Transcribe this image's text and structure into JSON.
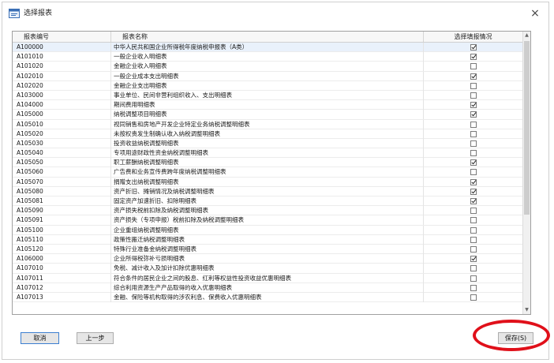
{
  "window": {
    "title": "选择报表",
    "close_glyph": "×"
  },
  "table": {
    "headers": [
      "报表编号",
      "报表名称",
      "选择填报情况"
    ],
    "rows": [
      {
        "code": "A100000",
        "name": "中华人民共和国企业所得税年度纳税申报表（A类）",
        "checked": true
      },
      {
        "code": "A101010",
        "name": "一般企业收入明细表",
        "checked": true
      },
      {
        "code": "A101020",
        "name": "金融企业收入明细表",
        "checked": false
      },
      {
        "code": "A102010",
        "name": "一般企业成本支出明细表",
        "checked": true
      },
      {
        "code": "A102020",
        "name": "金融企业支出明细表",
        "checked": false
      },
      {
        "code": "A103000",
        "name": "事业单位、民间非营利组织收入、支出明细表",
        "checked": false
      },
      {
        "code": "A104000",
        "name": "期间费用明细表",
        "checked": true
      },
      {
        "code": "A105000",
        "name": "纳税调整项目明细表",
        "checked": true
      },
      {
        "code": "A105010",
        "name": "视同销售和房地产开发企业特定业务纳税调整明细表",
        "checked": false
      },
      {
        "code": "A105020",
        "name": "未按权责发生制确认收入纳税调整明细表",
        "checked": false
      },
      {
        "code": "A105030",
        "name": "投资收益纳税调整明细表",
        "checked": false
      },
      {
        "code": "A105040",
        "name": "专项用途财政性资金纳税调整明细表",
        "checked": false
      },
      {
        "code": "A105050",
        "name": "职工薪酬纳税调整明细表",
        "checked": true
      },
      {
        "code": "A105060",
        "name": "广告费和业务宣传费跨年度纳税调整明细表",
        "checked": false
      },
      {
        "code": "A105070",
        "name": "捐赠支出纳税调整明细表",
        "checked": true
      },
      {
        "code": "A105080",
        "name": "资产折旧、摊销情况及纳税调整明细表",
        "checked": true
      },
      {
        "code": "A105081",
        "name": "固定资产加速折旧、扣除明细表",
        "checked": true
      },
      {
        "code": "A105090",
        "name": "资产损失税前扣除及纳税调整明细表",
        "checked": false
      },
      {
        "code": "A105091",
        "name": "资产损失（专项申报）税前扣除及纳税调整明细表",
        "checked": false
      },
      {
        "code": "A105100",
        "name": "企业重组纳税调整明细表",
        "checked": false
      },
      {
        "code": "A105110",
        "name": "政策性搬迁纳税调整明细表",
        "checked": false
      },
      {
        "code": "A105120",
        "name": "特殊行业准备金纳税调整明细表",
        "checked": false
      },
      {
        "code": "A106000",
        "name": "企业所得税弥补亏损明细表",
        "checked": true
      },
      {
        "code": "A107010",
        "name": "免税、减计收入及加计扣除优惠明细表",
        "checked": false
      },
      {
        "code": "A107011",
        "name": "符合条件的居民企业之间的股息、红利等权益性投资收益优惠明细表",
        "checked": false
      },
      {
        "code": "A107012",
        "name": "综合利用资源生产产品取得的收入优惠明细表",
        "checked": false
      },
      {
        "code": "A107013",
        "name": "金融、保险等机构取得的涉农利息、保费收入优惠明细表",
        "checked": false
      }
    ]
  },
  "buttons": {
    "cancel": "取消",
    "prev": "上一步",
    "save": "保存(S)"
  },
  "colors": {
    "annotation": "#e0101a",
    "selected_row": "#e9f1fb"
  }
}
